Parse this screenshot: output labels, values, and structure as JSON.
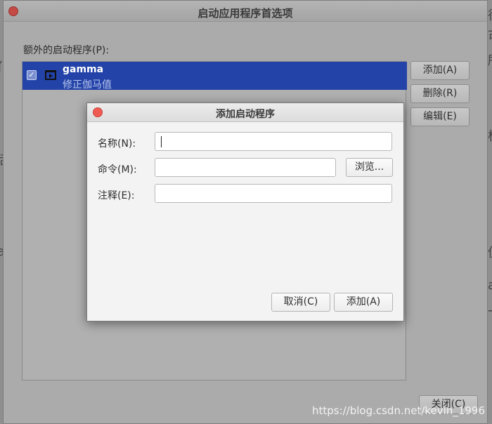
{
  "main_window": {
    "title": "启动应用程序首选项",
    "list_label": "额外的启动程序(P):",
    "items": [
      {
        "name": "gamma",
        "comment": "修正伽马值",
        "enabled": true
      }
    ],
    "buttons": {
      "add": "添加(A)",
      "remove": "删除(R)",
      "edit": "编辑(E)",
      "close": "关闭(C)"
    }
  },
  "dialog": {
    "title": "添加启动程序",
    "name_label": "名称(N):",
    "name_value": "",
    "command_label": "命令(M):",
    "command_value": "",
    "browse": "浏览...",
    "comment_label": "注释(E):",
    "comment_value": "",
    "cancel": "取消(C)",
    "add": "添加(A)"
  },
  "watermark": "https://blog.csdn.net/kevin_1996",
  "colors": {
    "selection": "#2343a8",
    "close_button": "#ef5a52"
  }
}
